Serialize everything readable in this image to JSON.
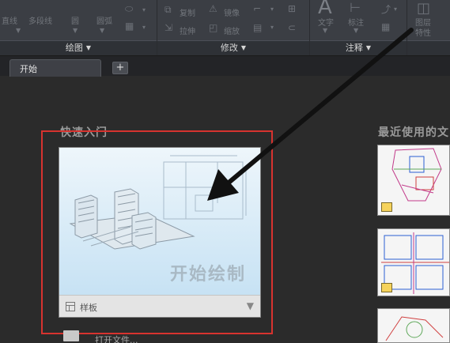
{
  "ribbon": {
    "panels": [
      {
        "title": "绘图",
        "items": [
          "直线",
          "多段线",
          "圆",
          "圆弧"
        ]
      },
      {
        "title": "修改",
        "items": [
          "复制",
          "镜像",
          "拉伸",
          "缩放"
        ]
      },
      {
        "title": "注释",
        "items": [
          "文字",
          "标注"
        ]
      },
      {
        "title": "",
        "items": [
          "图层",
          "特性"
        ]
      }
    ]
  },
  "tabs": {
    "start_label": "开始",
    "add_label": "+"
  },
  "quick_start": {
    "title": "快速入门",
    "card_label": "开始绘制",
    "template_label": "样板",
    "open_files_label": "打开文件..."
  },
  "recent": {
    "title": "最近使用的文"
  },
  "colors": {
    "highlight": "#d7332f",
    "background": "#2b2b2b"
  }
}
